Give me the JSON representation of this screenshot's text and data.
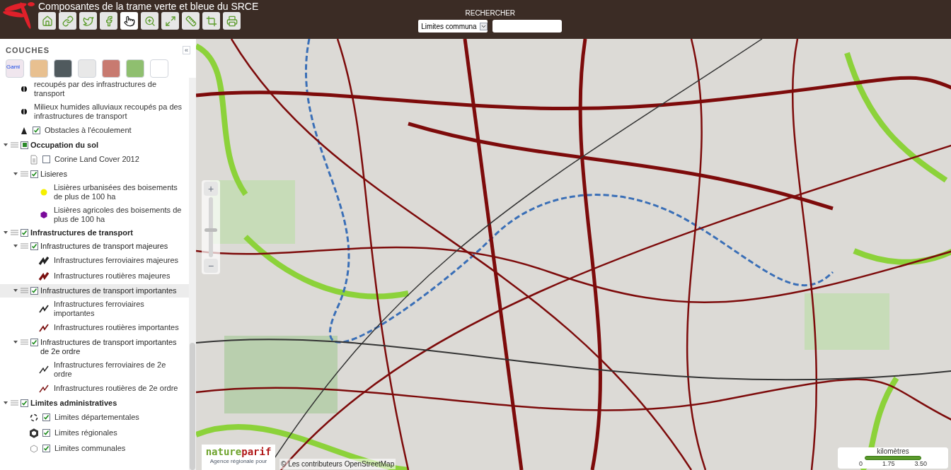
{
  "header": {
    "title": "Composantes de la trame verte et bleue du SRCE",
    "tools": [
      {
        "kind": "home",
        "selected": false
      },
      {
        "kind": "link",
        "selected": false
      },
      {
        "kind": "twitter",
        "selected": false
      },
      {
        "kind": "facebook",
        "selected": false
      },
      {
        "kind": "pan",
        "selected": true
      },
      {
        "kind": "zoom",
        "selected": false
      },
      {
        "kind": "extent",
        "selected": false
      },
      {
        "kind": "measure",
        "selected": false
      },
      {
        "kind": "crop",
        "selected": false
      },
      {
        "kind": "print",
        "selected": false
      }
    ],
    "search": {
      "label": "RECHERCHER",
      "select_value": "Limites communa"
    }
  },
  "sidebar": {
    "title": "COUCHES",
    "collapse": "«",
    "basemaps": [
      {
        "kind": "plan",
        "label": "Gami"
      },
      {
        "kind": "roads"
      },
      {
        "kind": "aerial"
      },
      {
        "kind": "blank"
      },
      {
        "kind": "buildings"
      },
      {
        "kind": "relief"
      },
      {
        "kind": "white"
      }
    ],
    "layers": [
      {
        "kind": "wetland",
        "label": "recoupés par des infrastructures de transport"
      },
      {
        "kind": "wetland",
        "label": "Milieux humides alluviaux recoupés pa des infrastructures de transport"
      },
      {
        "kind": "obstacle",
        "checked": true,
        "label": "Obstacles à l'écoulement"
      },
      {
        "kind": "group",
        "bold": true,
        "expanded": true,
        "checked": true,
        "partial": true,
        "selected": false,
        "label": "Occupation du sol",
        "children": [
          {
            "kind": "document",
            "checked": false,
            "label": "Corine Land Cover 2012"
          },
          {
            "kind": "group",
            "bold": false,
            "expanded": true,
            "checked": true,
            "partial": false,
            "selected": false,
            "label": "Lisieres",
            "children": [
              {
                "kind": "dot",
                "color": "#f5f000",
                "label": "Lisières urbanisées des boisements de plus de 100 ha"
              },
              {
                "kind": "hexagon",
                "color": "#7a0a9a",
                "label": "Lisières agricoles des boisements de plus de 100 ha"
              }
            ]
          }
        ]
      },
      {
        "kind": "group",
        "bold": true,
        "expanded": true,
        "checked": true,
        "partial": false,
        "selected": false,
        "label": "Infrastructures de transport",
        "children": [
          {
            "kind": "group",
            "bold": false,
            "expanded": true,
            "checked": true,
            "partial": false,
            "selected": false,
            "label": "Infrastructures de transport majeures",
            "children": [
              {
                "kind": "line-thick",
                "color": "#222222",
                "label": "Infrastructures ferroviaires majeures"
              },
              {
                "kind": "line-thick",
                "color": "#7a0f0f",
                "label": "Infrastructures routières majeures"
              }
            ]
          },
          {
            "kind": "group",
            "bold": false,
            "expanded": true,
            "checked": true,
            "partial": false,
            "selected": true,
            "label": "Infrastructures de transport importantes",
            "children": [
              {
                "kind": "line",
                "color": "#222222",
                "label": "Infrastructures ferroviaires importantes"
              },
              {
                "kind": "line",
                "color": "#7a0f0f",
                "label": "Infrastructures routières importantes"
              }
            ]
          },
          {
            "kind": "group",
            "bold": false,
            "expanded": true,
            "checked": true,
            "partial": false,
            "selected": false,
            "label": "Infrastructures de transport importantes de 2e ordre",
            "children": [
              {
                "kind": "line-thin",
                "color": "#222222",
                "label": "Infrastructures ferroviaires de 2e ordre"
              },
              {
                "kind": "line-thin",
                "color": "#7a0f0f",
                "label": "Infrastructures routières de 2e ordre"
              }
            ]
          }
        ]
      },
      {
        "kind": "group",
        "bold": true,
        "expanded": true,
        "checked": true,
        "partial": false,
        "selected": false,
        "label": "Limites administratives",
        "children": [
          {
            "kind": "dashed-ring",
            "checked": true,
            "label": "Limites départementales"
          },
          {
            "kind": "thick-ring",
            "checked": true,
            "label": "Limites régionales"
          },
          {
            "kind": "thin-ring",
            "checked": true,
            "label": "Limites communales"
          }
        ]
      }
    ]
  },
  "map": {
    "zoom_in": "+",
    "zoom_out": "−",
    "zoom": {
      "level": 0.45
    },
    "logo": {
      "name_a": "nature",
      "name_b": "parif",
      "tagline": "Agence régionale pour"
    },
    "attribution": "© Les contributeurs OpenStreetMap",
    "scale": {
      "unit": "kilomètres",
      "ticks": [
        "0",
        "1.75",
        "3.50"
      ]
    }
  }
}
